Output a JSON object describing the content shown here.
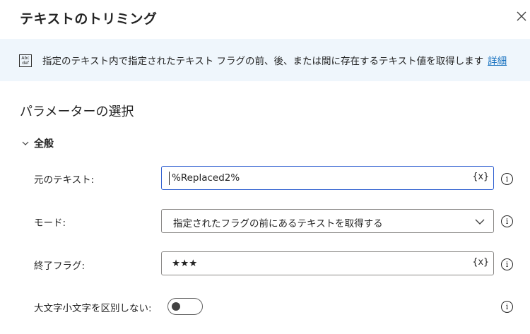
{
  "dialog": {
    "title": "テキストのトリミング",
    "close_icon": "close-icon"
  },
  "banner": {
    "icon": "text-abc-def-icon",
    "icon_text_top": "Abc",
    "icon_text_bottom": "def",
    "description": "指定のテキスト内で指定されたテキスト フラグの前、後、または間に存在するテキスト値を取得します",
    "link": "詳細",
    "background": "#eff6fc",
    "link_color": "#0f6cbd"
  },
  "section": {
    "title": "パラメーターの選択",
    "group_label": "全般"
  },
  "fields": {
    "original_text": {
      "label": "元のテキスト:",
      "value": "%Replaced2%",
      "var_button": "{x}"
    },
    "mode": {
      "label": "モード:",
      "value": "指定されたフラグの前にあるテキストを取得する"
    },
    "end_flag": {
      "label": "終了フラグ:",
      "value": "★★★",
      "var_button": "{x}"
    },
    "ignore_case": {
      "label": "大文字小文字を区別しない:",
      "checked": false
    }
  },
  "info_icon": "i",
  "accent": "#2f5fd0"
}
